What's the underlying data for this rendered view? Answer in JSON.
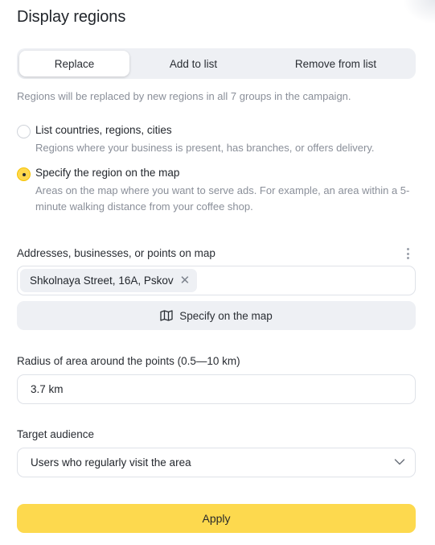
{
  "title": "Display regions",
  "tabs": [
    {
      "label": "Replace",
      "active": true
    },
    {
      "label": "Add to list",
      "active": false
    },
    {
      "label": "Remove from list",
      "active": false
    }
  ],
  "hint": "Regions will be replaced by new regions in all 7 groups in the campaign.",
  "options": [
    {
      "label": "List countries, regions, cities",
      "description": "Regions where your business is present, has branches, or offers delivery.",
      "checked": false
    },
    {
      "label": "Specify the region on the map",
      "description": "Areas on the map where you want to serve ads. For example, an area within a 5-minute walking distance from your coffee shop.",
      "checked": true
    }
  ],
  "addresses": {
    "label": "Addresses, businesses, or points on map",
    "chips": [
      "Shkolnaya Street, 16A, Pskov"
    ],
    "remove_glyph": "✕",
    "map_button_label": "Specify on the map",
    "more_icon": "kebab-icon"
  },
  "radius": {
    "label": "Radius of area around the points (0.5—10 km)",
    "value": "3.7 km"
  },
  "audience": {
    "label": "Target audience",
    "value": "Users who regularly visit the area"
  },
  "apply_label": "Apply",
  "colors": {
    "accent": "#fdd94e",
    "muted_text": "#8a8f99",
    "surface": "#eef0f4"
  }
}
